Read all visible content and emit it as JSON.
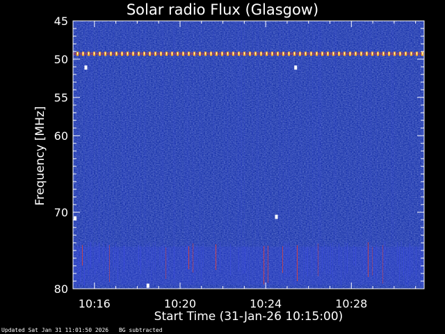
{
  "chart_data": {
    "type": "heatmap",
    "title": "Solar radio Flux (Glasgow)",
    "xlabel": "Start Time (31-Jan-26 10:15:00)",
    "ylabel": "Frequency [MHz]",
    "x_unit": "minutes past 10:00",
    "xlim": [
      15.0,
      31.4
    ],
    "ylim": [
      45,
      80
    ],
    "x_ticks": [
      {
        "value": 16,
        "label": "10:16"
      },
      {
        "value": 20,
        "label": "10:20"
      },
      {
        "value": 24,
        "label": "10:24"
      },
      {
        "value": 28,
        "label": "10:28"
      }
    ],
    "y_ticks": [
      {
        "value": 45,
        "label": "45"
      },
      {
        "value": 50,
        "label": "50"
      },
      {
        "value": 55,
        "label": "55"
      },
      {
        "value": 60,
        "label": "60"
      },
      {
        "value": 70,
        "label": "70"
      },
      {
        "value": 80,
        "label": "80"
      }
    ],
    "features": {
      "interference_band_mhz": 49.3,
      "lower_band_mhz": [
        74.5,
        79.5
      ],
      "bright_spots": [
        {
          "x": 15.6,
          "y": 51.1
        },
        {
          "x": 25.4,
          "y": 51.1
        },
        {
          "x": 15.1,
          "y": 70.8
        },
        {
          "x": 24.5,
          "y": 70.6
        },
        {
          "x": 18.5,
          "y": 79.6
        }
      ]
    },
    "colors": {
      "background": "#000000",
      "low": "#1a2a9a",
      "mid": "#3a4ae0",
      "high": "#ff3c1e",
      "peak": "#ffffff"
    }
  },
  "footer": {
    "updated": "Updated Sat Jan 31 11:01:50 2026",
    "note": "BG subtracted"
  }
}
